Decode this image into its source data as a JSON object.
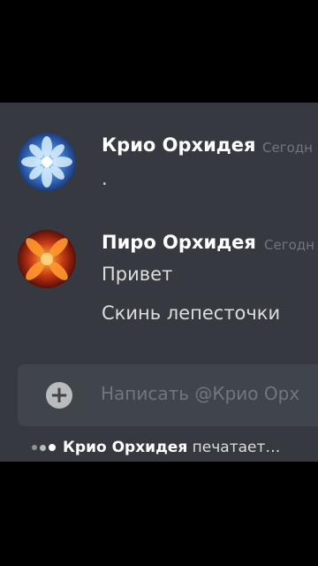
{
  "messages": [
    {
      "author": "Крио Орхидея",
      "timestamp": "Сегодн",
      "lines": [
        "."
      ],
      "avatar_icon": "blue-flower-icon",
      "avatar_color": "#2f5fb0"
    },
    {
      "author": "Пиро Орхидея",
      "timestamp": "Сегодн",
      "lines": [
        "Привет",
        "Скинь лепесточки"
      ],
      "avatar_icon": "red-flower-icon",
      "avatar_color": "#a02a12"
    }
  ],
  "composer": {
    "add_icon": "plus-icon",
    "placeholder": "Написать @Крио Орх"
  },
  "typing": {
    "name": "Крио Орхидея",
    "text": "печатает…"
  }
}
